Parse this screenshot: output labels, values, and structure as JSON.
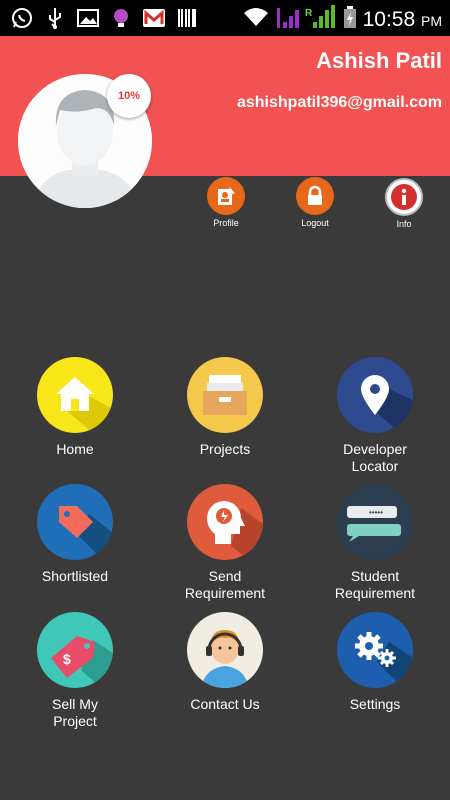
{
  "status_bar": {
    "time": "10:58",
    "ampm": "PM",
    "icons": [
      "whatsapp-icon",
      "usb-icon",
      "image-icon",
      "notification-icon",
      "gmail-icon",
      "barcode-icon",
      "wifi-icon",
      "signal-icon",
      "battery-icon"
    ]
  },
  "profile": {
    "name": "Ashish Patil",
    "email": "ashishpatil396@gmail.com",
    "completion": "10%"
  },
  "quick_actions": [
    {
      "label": "Profile",
      "icon": "profile-icon",
      "color": "#e8681a"
    },
    {
      "label": "Logout",
      "icon": "lock-icon",
      "color": "#e8681a"
    },
    {
      "label": "Info",
      "icon": "info-icon",
      "color": "#d32f2f"
    }
  ],
  "menu": [
    {
      "label": "Home",
      "icon": "home-icon",
      "color": "#f7e718"
    },
    {
      "label": "Projects",
      "icon": "folder-icon",
      "color": "#f4c84a"
    },
    {
      "label": "Developer\nLocator",
      "icon": "location-pin-icon",
      "color": "#2e4a8f"
    },
    {
      "label": "Shortlisted",
      "icon": "tag-icon",
      "color": "#1f6fb8"
    },
    {
      "label": "Send\nRequirement",
      "icon": "head-idea-icon",
      "color": "#e05a3c"
    },
    {
      "label": "Student\nRequirement",
      "icon": "chat-icon",
      "color": "#2c3e50"
    },
    {
      "label": "Sell My\nProject",
      "icon": "price-tag-icon",
      "color": "#3fc8b7"
    },
    {
      "label": "Contact Us",
      "icon": "support-agent-icon",
      "color": "#f2ede2"
    },
    {
      "label": "Settings",
      "icon": "gears-icon",
      "color": "#1d5fae"
    }
  ]
}
